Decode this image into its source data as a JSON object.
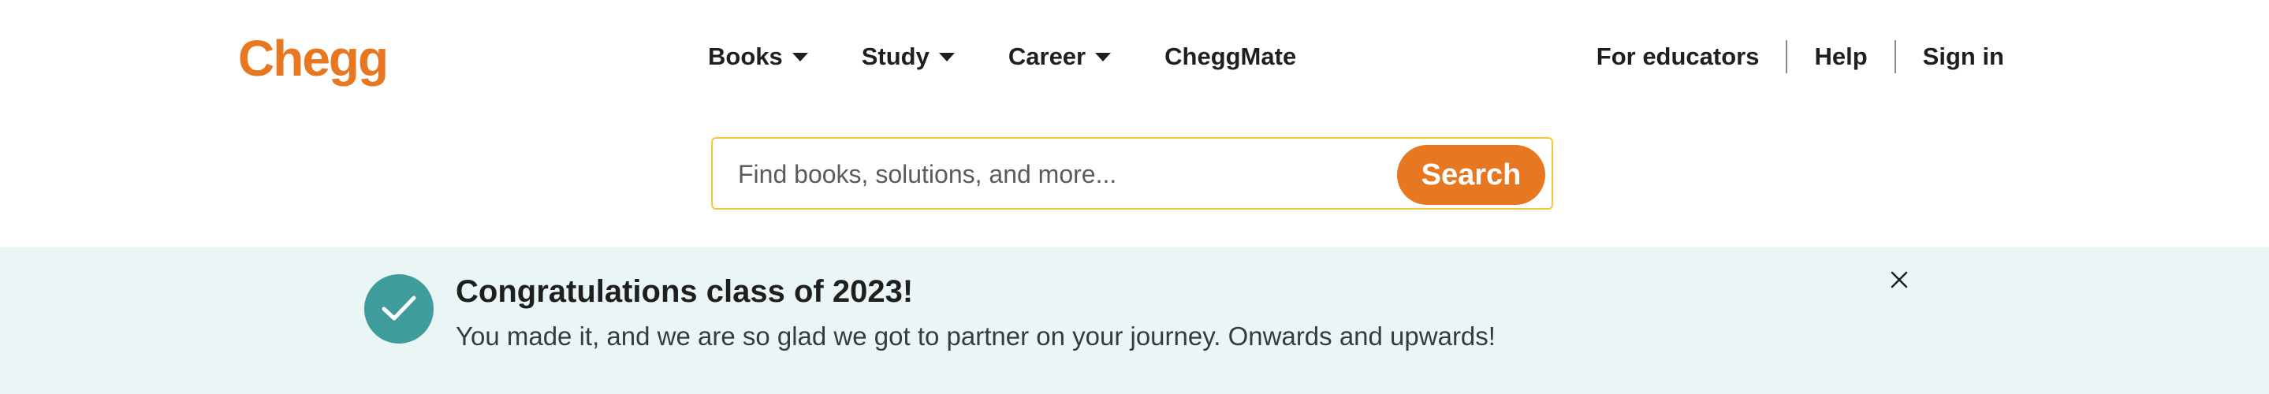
{
  "header": {
    "logo": "Chegg",
    "nav": [
      {
        "label": "Books",
        "icon": "caret-down-icon"
      },
      {
        "label": "Study",
        "icon": "caret-down-icon"
      },
      {
        "label": "Career",
        "icon": "caret-down-icon"
      },
      {
        "label": "CheggMate"
      }
    ],
    "right_links": [
      "For educators",
      "Help",
      "Sign in"
    ]
  },
  "search": {
    "placeholder": "Find books, solutions, and more...",
    "button_label": "Search"
  },
  "banner": {
    "icon": "checkmark-icon",
    "title": "Congratulations class of 2023!",
    "message": "You made it, and we are so glad we got to partner on your journey. Onwards and upwards!",
    "close_icon": "close-icon"
  },
  "colors": {
    "brand": "#e87722",
    "banner_bg": "#eaf6f6",
    "check_bg": "#3f9c9c",
    "search_border": "#f3c640"
  }
}
